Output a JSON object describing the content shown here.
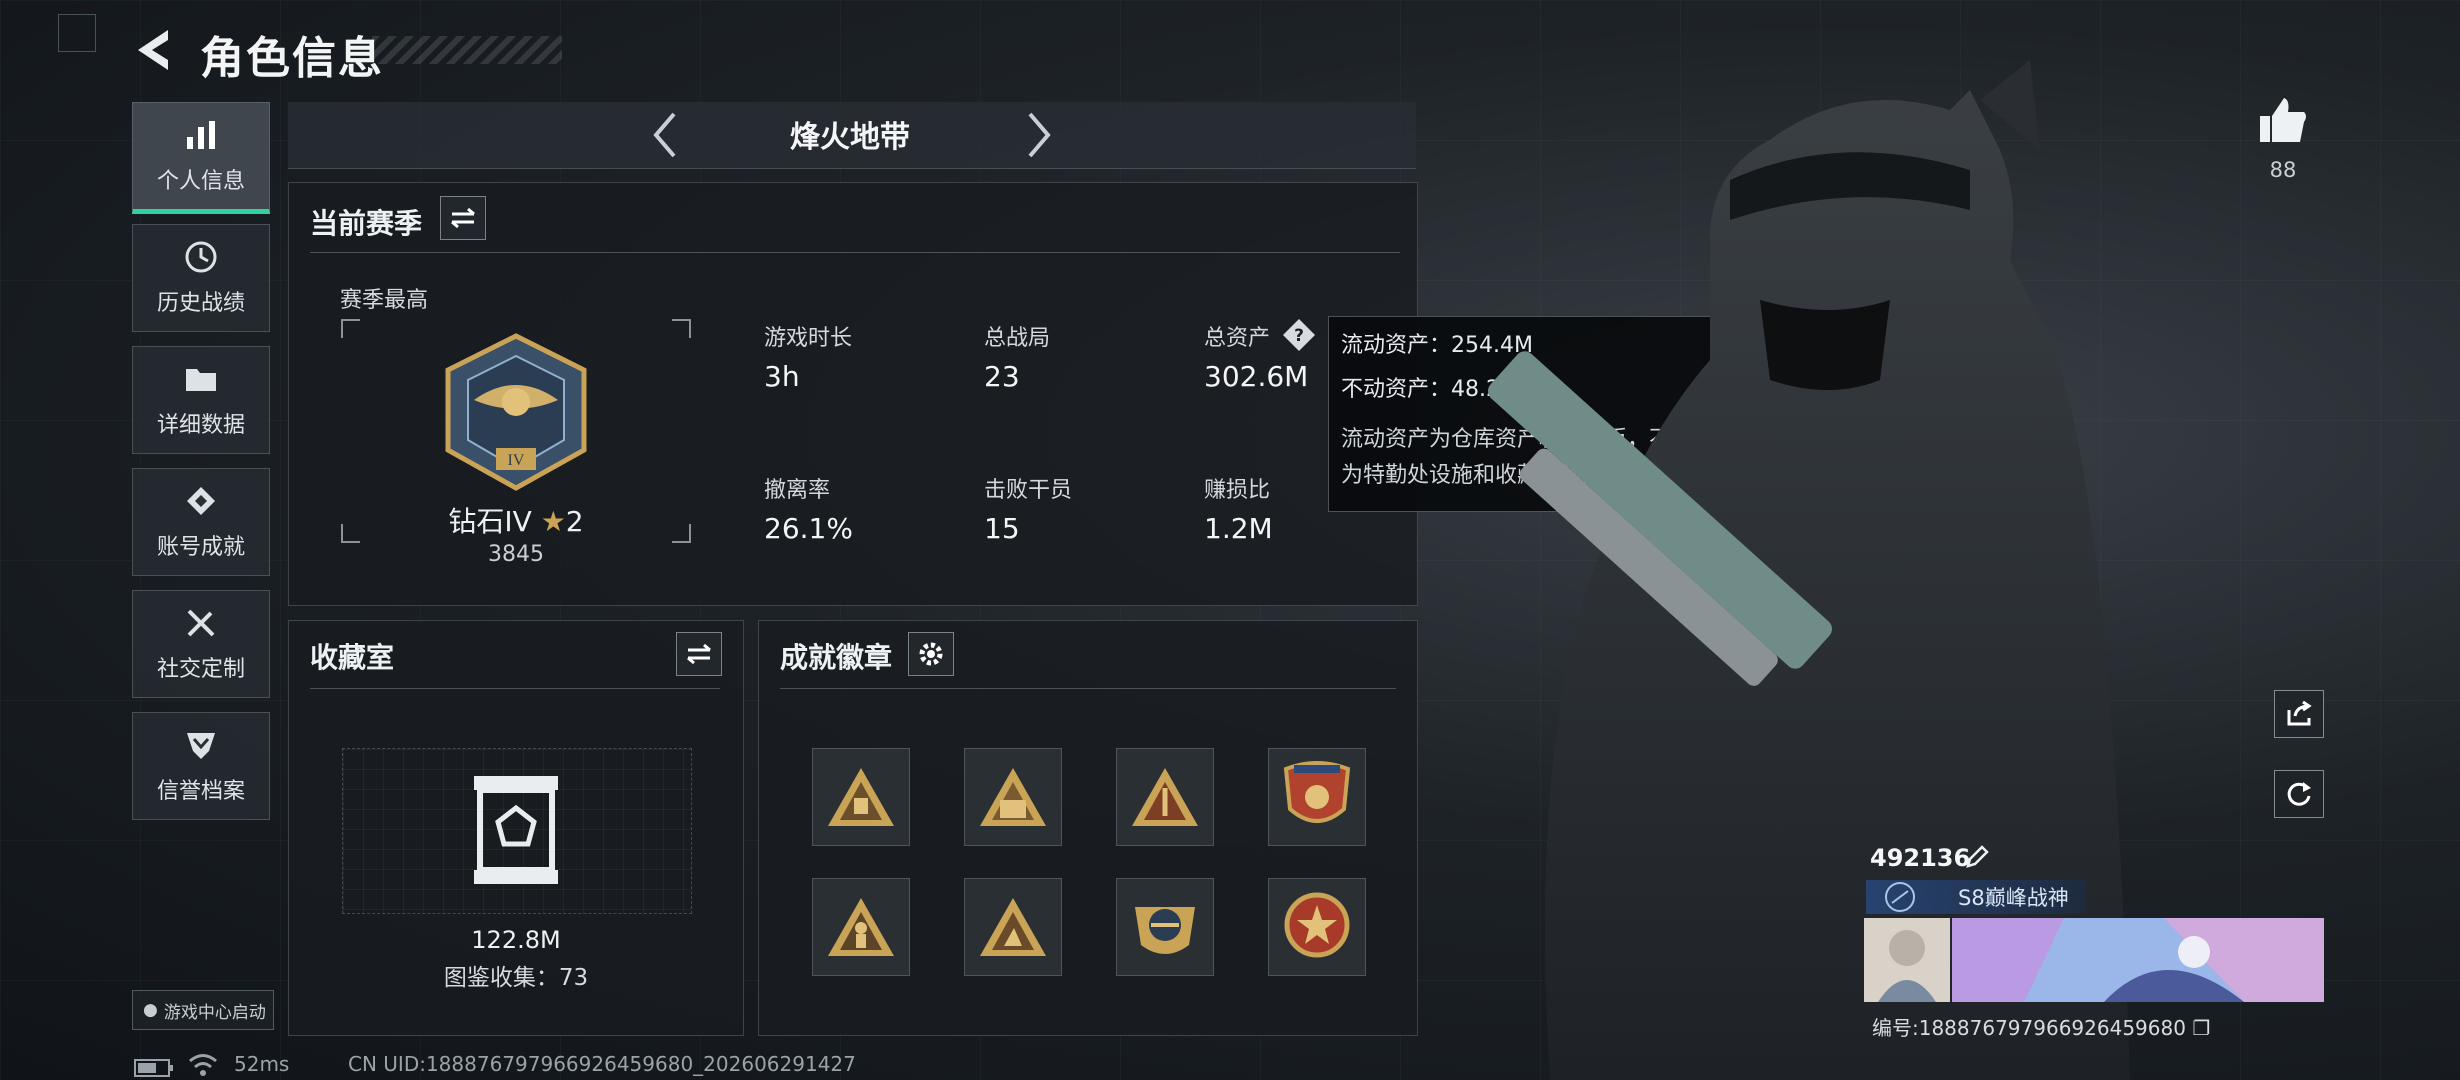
{
  "header": {
    "title": "角色信息"
  },
  "sidebar": {
    "items": [
      {
        "label": "个人信息",
        "active": true,
        "icon": "bar-chart-icon"
      },
      {
        "label": "历史战绩",
        "icon": "history-clock-icon"
      },
      {
        "label": "详细数据",
        "icon": "folder-icon"
      },
      {
        "label": "账号成就",
        "icon": "diamond-medal-icon"
      },
      {
        "label": "社交定制",
        "icon": "wrench-icon"
      },
      {
        "label": "信誉档案",
        "icon": "shield-chevron-icon"
      }
    ],
    "launch_badge": "游戏中心启动"
  },
  "mode": {
    "name": "烽火地带"
  },
  "season": {
    "title": "当前赛季",
    "best_label": "赛季最高",
    "rank_name": "钻石IV",
    "rank_stars": "2",
    "rank_points": "3845",
    "rank_emblem_text": "IV",
    "stats": [
      {
        "label": "游戏时长",
        "value": "3h"
      },
      {
        "label": "总战局",
        "value": "23"
      },
      {
        "label": "总资产",
        "value": "302.6M"
      },
      {
        "label": "撤离率",
        "value": "26.1%"
      },
      {
        "label": "击败干员",
        "value": "15"
      },
      {
        "label": "赚损比",
        "value": "1.2M"
      }
    ]
  },
  "tooltip": {
    "liquid": "流动资产：254.4M",
    "fixed": "不动资产：48.2M",
    "note_line1": "流动资产为仓库资产和哈夫币，不动资产",
    "note_line2": "为特勤处设施和收藏室设施"
  },
  "collection": {
    "title": "收藏室",
    "value": "122.8M",
    "catalog": "图鉴收集：73"
  },
  "achievements": {
    "title": "成就徽章",
    "badges": [
      "triangle-crate-badge",
      "triangle-pyramid-badge",
      "triangle-supply-badge",
      "shield-crest-badge",
      "triangle-soldier-badge",
      "triangle-runner-badge",
      "round-emblem-badge",
      "star-wreath-badge"
    ]
  },
  "footer": {
    "ping": "52ms",
    "uid": "CN UID:18887679796692645968​0_202606291427"
  },
  "profile": {
    "likes": "88",
    "player_id": "492136",
    "title_tag": "S8巅峰战神",
    "uid_label": "编号:18887679796692645968​0"
  },
  "colors": {
    "accent": "#32d1a4",
    "gold": "#c9a356",
    "panel_bg": "#181c21"
  }
}
